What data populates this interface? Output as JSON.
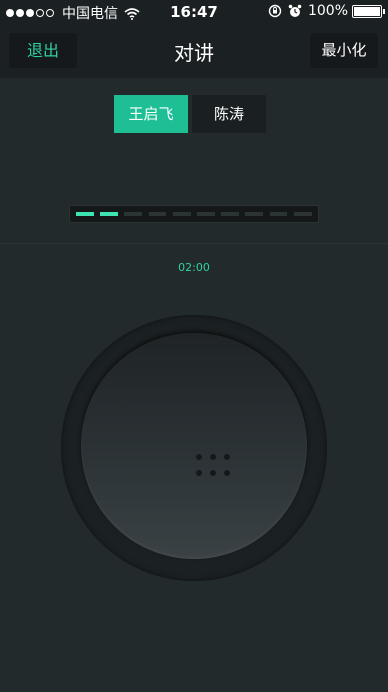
{
  "status_bar": {
    "signal_bars_filled": 3,
    "signal_bars_total": 5,
    "carrier": "中国电信",
    "time": "16:47",
    "battery_percent": "100%",
    "icons": [
      "wifi-icon",
      "rotation-lock-icon",
      "alarm-icon",
      "battery-icon"
    ]
  },
  "nav": {
    "exit_label": "退出",
    "title": "对讲",
    "minimize_label": "最小化"
  },
  "tabs": [
    {
      "label": "王启飞",
      "active": true
    },
    {
      "label": "陈涛",
      "active": false
    }
  ],
  "volume_meter": {
    "segments_total": 10,
    "segments_active": 2
  },
  "timer": "02:00",
  "colors": {
    "accent": "#2fd1a4",
    "tab_active": "#1fbf95",
    "background": "#222a2c",
    "bar_background": "#1b2022"
  }
}
